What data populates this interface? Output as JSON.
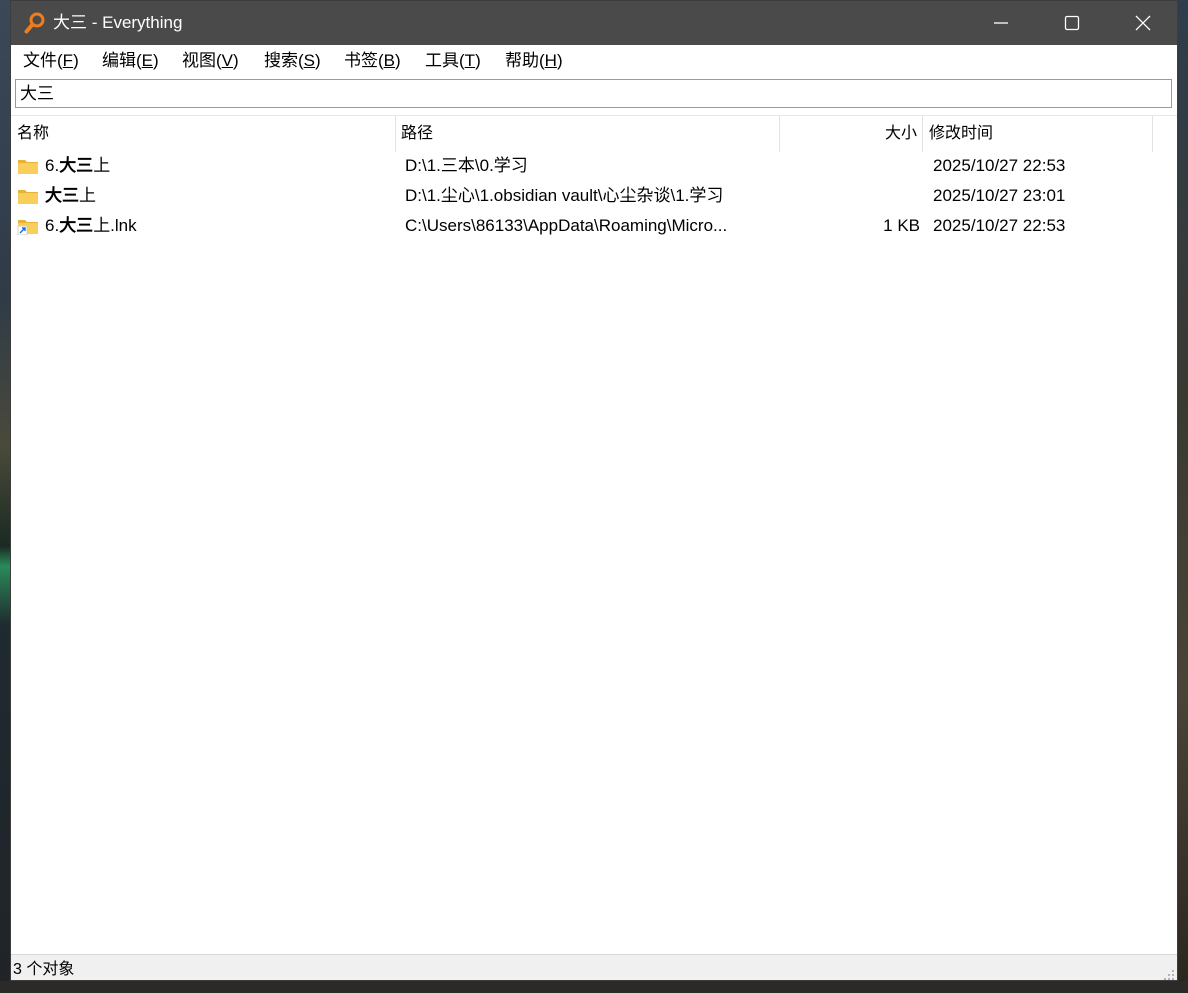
{
  "window": {
    "title": "大三 - Everything"
  },
  "menu": [
    {
      "label": "文件(",
      "key": "F",
      "close": ")"
    },
    {
      "label": "编辑(",
      "key": "E",
      "close": ")"
    },
    {
      "label": "视图(",
      "key": "V",
      "close": ")"
    },
    {
      "label": "搜索(",
      "key": "S",
      "close": ")"
    },
    {
      "label": "书签(",
      "key": "B",
      "close": ")"
    },
    {
      "label": "工具(",
      "key": "T",
      "close": ")"
    },
    {
      "label": "帮助(",
      "key": "H",
      "close": ")"
    }
  ],
  "search": {
    "value": "大三"
  },
  "columns": {
    "name": "名称",
    "path": "路径",
    "size": "大小",
    "modified": "修改时间"
  },
  "rows": [
    {
      "icon": "folder-icon",
      "name_prefix": "6.",
      "name_match": "大三",
      "name_suffix": "上",
      "path": "D:\\1.三本\\0.学习",
      "size": "",
      "modified": "2025/10/27 22:53"
    },
    {
      "icon": "folder-icon",
      "name_prefix": "",
      "name_match": "大三",
      "name_suffix": "上",
      "path": "D:\\1.尘心\\1.obsidian vault\\心尘杂谈\\1.学习",
      "size": "",
      "modified": "2025/10/27 23:01"
    },
    {
      "icon": "shortcut-folder-icon",
      "name_prefix": "6.",
      "name_match": "大三",
      "name_suffix": "上.lnk",
      "path": "C:\\Users\\86133\\AppData\\Roaming\\Micro...",
      "size": "1 KB",
      "modified": "2025/10/27 22:53"
    }
  ],
  "status": {
    "text": "3 个对象"
  },
  "colors": {
    "titlebar": "#4a4a4a",
    "folder": "#f5c542",
    "accent_icon": "#f07c1b"
  }
}
